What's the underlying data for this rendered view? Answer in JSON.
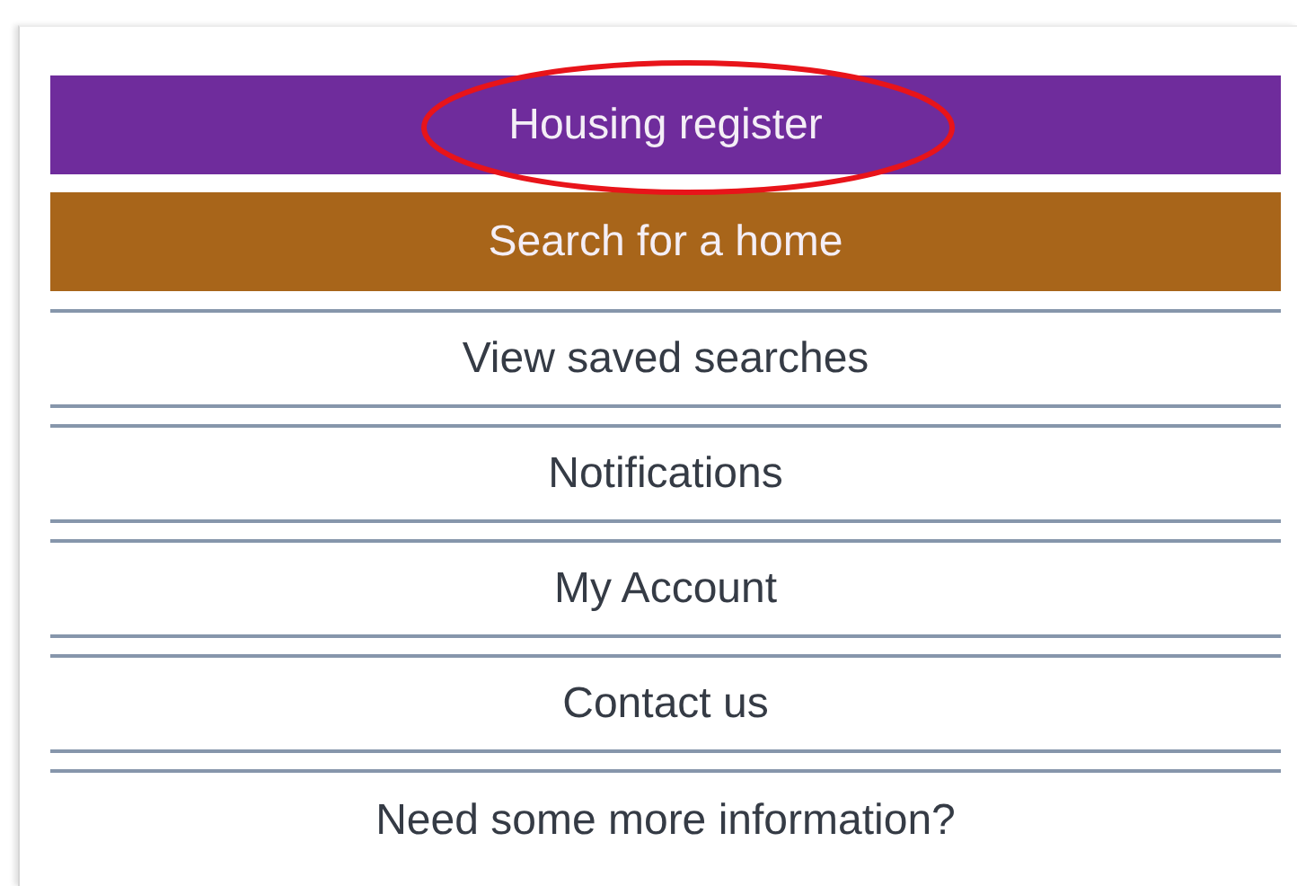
{
  "menu": [
    {
      "label": "Housing register",
      "kind": "filled",
      "color": "#6f2c9c",
      "circled": true
    },
    {
      "label": "Search for a home",
      "kind": "filled",
      "color": "#a8651a",
      "circled": false
    },
    {
      "label": "View saved searches",
      "kind": "plain",
      "circled": false
    },
    {
      "label": "Notifications",
      "kind": "plain",
      "circled": false
    },
    {
      "label": "My Account",
      "kind": "plain",
      "circled": false
    },
    {
      "label": "Contact us",
      "kind": "plain",
      "circled": false
    },
    {
      "label": "Need some more information?",
      "kind": "plain",
      "circled": false
    }
  ]
}
